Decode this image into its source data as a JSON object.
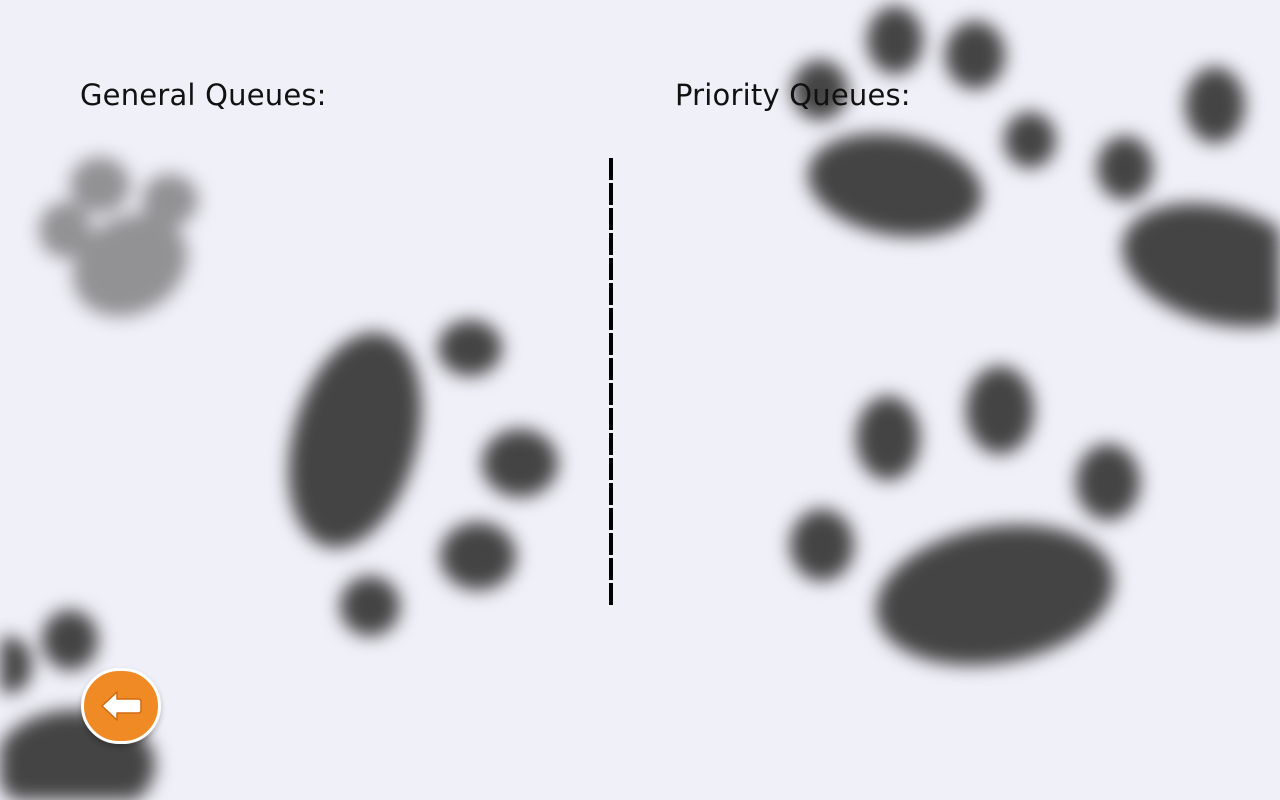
{
  "sections": {
    "general_title": "General Queues:",
    "priority_title": "Priority Queues:"
  },
  "navigation": {
    "back_icon": "back-arrow-icon"
  },
  "colors": {
    "background": "#f0f0f8",
    "paw": "#444444",
    "back_button": "#f08a24",
    "heading_text": "#111111"
  }
}
